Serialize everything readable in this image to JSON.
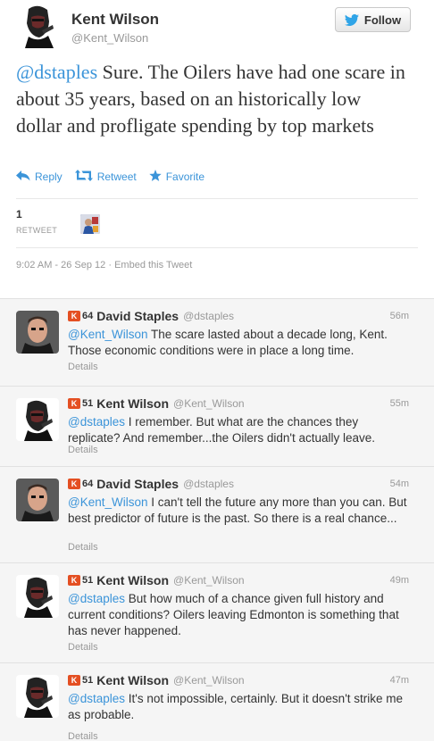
{
  "tweet": {
    "author_name": "Kent Wilson",
    "author_handle": "@Kent_Wilson",
    "follow_label": "Follow",
    "mention": "@dstaples",
    "text": " Sure. The Oilers have had one scare in about 35 years, based on an historically low dollar and profligate spending by top markets",
    "actions": {
      "reply": "Reply",
      "retweet": "Retweet",
      "favorite": "Favorite"
    },
    "retweet_count": "1",
    "retweet_label": "RETWEET",
    "timestamp": "9:02 AM - 26 Sep 12",
    "separator": " · ",
    "embed_label": "Embed this Tweet"
  },
  "replies": [
    {
      "name": "David Staples",
      "handle": "@dstaples",
      "klout_icon": "K",
      "klout": "64",
      "time": "56m",
      "mention": "@Kent_Wilson",
      "text": " The scare lasted about a decade long, Kent. Those economic conditions were in place a long time.",
      "details": "Details",
      "avatar": "david"
    },
    {
      "name": "Kent Wilson",
      "handle": "@Kent_Wilson",
      "klout_icon": "K",
      "klout": "51",
      "time": "55m",
      "mention": "@dstaples",
      "text": " I remember. But what are the chances they replicate? And remember...the Oilers didn't actually leave.",
      "details": "Details",
      "avatar": "kent"
    },
    {
      "name": "David Staples",
      "handle": "@dstaples",
      "klout_icon": "K",
      "klout": "64",
      "time": "54m",
      "mention": "@Kent_Wilson",
      "text": " I can't tell the future any more than you can. But best predictor of future is the past. So there is a real chance...",
      "details": "Details",
      "avatar": "david"
    },
    {
      "name": "Kent Wilson",
      "handle": "@Kent_Wilson",
      "klout_icon": "K",
      "klout": "51",
      "time": "49m",
      "mention": "@dstaples",
      "text": " But how much of a chance given full history and current conditions? Oilers leaving Edmonton is something that has never happened.",
      "details": "Details",
      "avatar": "kent"
    },
    {
      "name": "Kent Wilson",
      "handle": "@Kent_Wilson",
      "klout_icon": "K",
      "klout": "51",
      "time": "47m",
      "mention": "@dstaples",
      "text": " It's not impossible, certainly. But it doesn't strike me as probable.",
      "details": "Details",
      "avatar": "kent"
    }
  ]
}
